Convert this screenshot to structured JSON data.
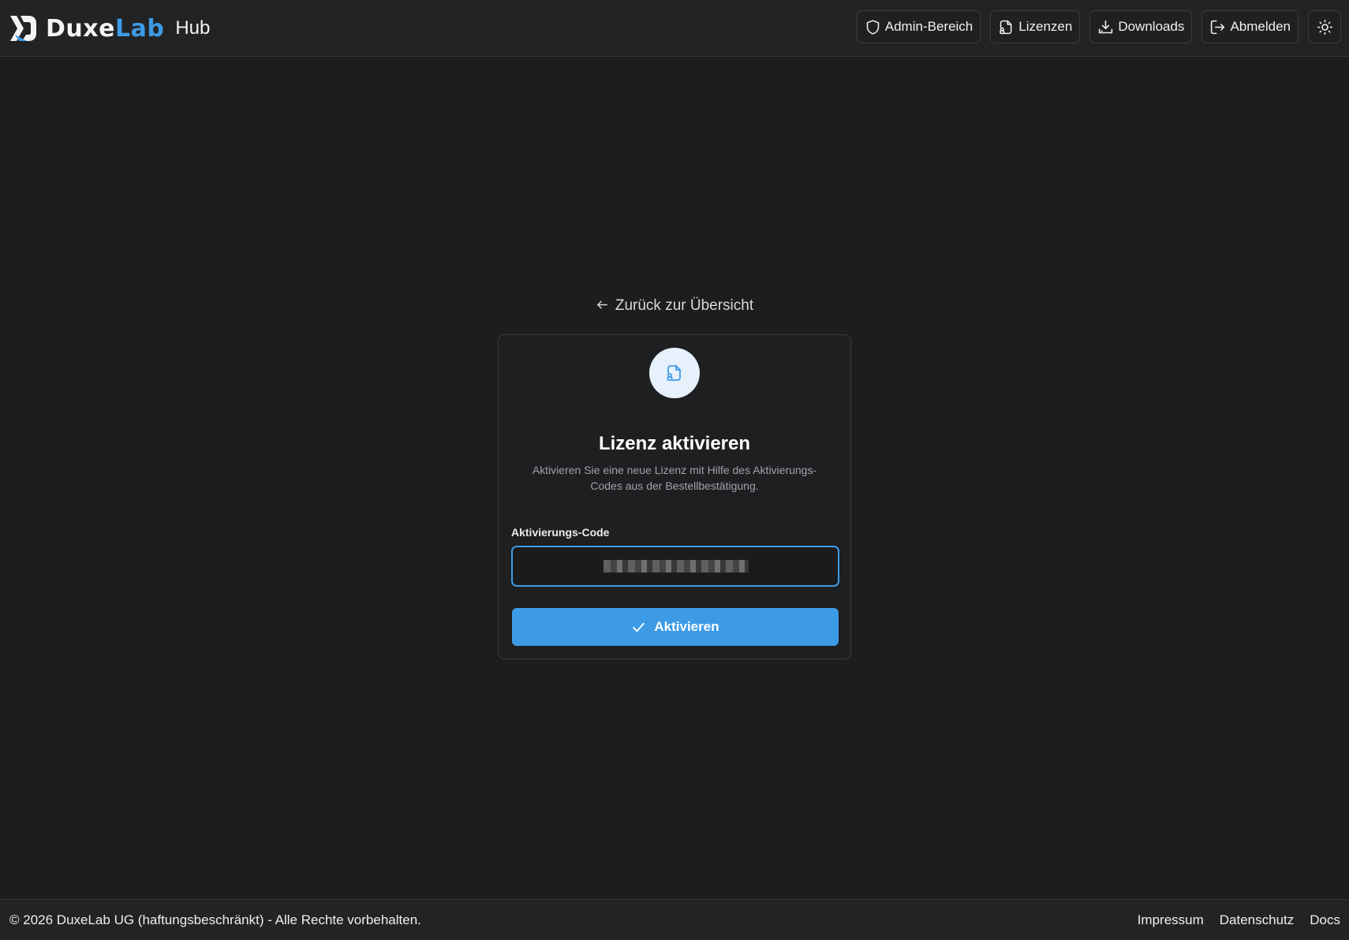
{
  "header": {
    "brand_part1": "Duxe",
    "brand_part2": "Lab",
    "hub_label": "Hub",
    "nav": [
      {
        "label": "Admin-Bereich",
        "icon": "shield-icon"
      },
      {
        "label": "Lizenzen",
        "icon": "license-file-icon"
      },
      {
        "label": "Downloads",
        "icon": "download-icon"
      },
      {
        "label": "Abmelden",
        "icon": "logout-icon"
      }
    ],
    "theme_toggle_icon": "sun-icon"
  },
  "main": {
    "back_link": "Zurück zur Übersicht",
    "card": {
      "icon": "license-file-icon",
      "title": "Lizenz aktivieren",
      "description": "Aktivieren Sie eine neue Lizenz mit Hilfe des Aktivierungs-Codes aus der Bestellbestätigung.",
      "field_label": "Aktivierungs-Code",
      "input_value": "",
      "submit_label": "Aktivieren"
    }
  },
  "footer": {
    "copyright": "© 2026 DuxeLab UG (haftungsbeschränkt) - Alle Rechte vorbehalten.",
    "links": [
      "Impressum",
      "Datenschutz",
      "Docs"
    ]
  },
  "colors": {
    "accent": "#3d9be6",
    "background": "#1c1d1f",
    "header_background": "#222325"
  }
}
